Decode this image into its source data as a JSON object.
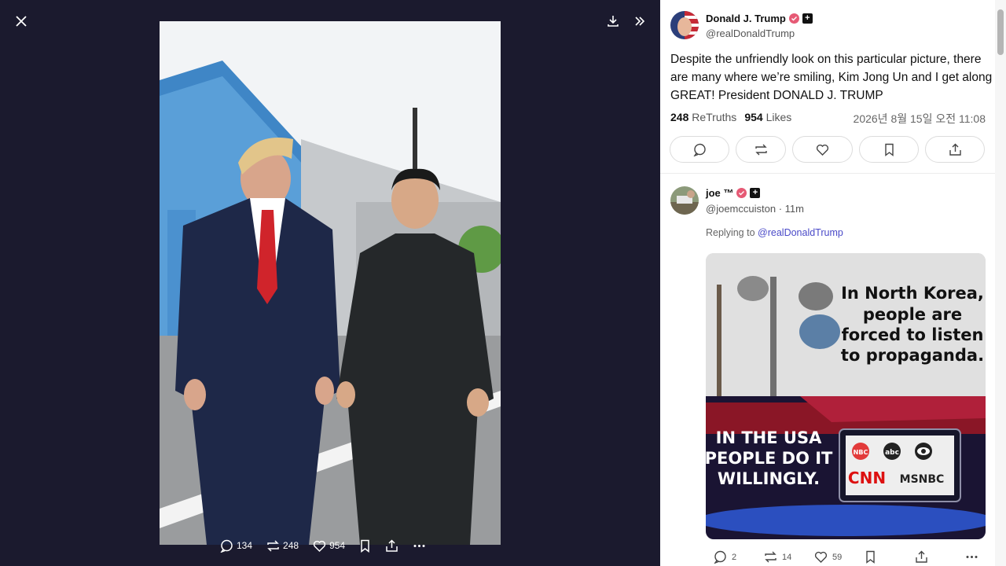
{
  "viewer": {
    "actions": {
      "replies": "134",
      "retruths": "248",
      "likes": "954"
    }
  },
  "post": {
    "author_name": "Donald J. Trump",
    "author_handle": "@realDonaldTrump",
    "text": "Despite the unfriendly look on this particular picture, there are many where we’re smiling, Kim Jong Un and I get along GREAT! President DONALD J. TRUMP",
    "retruths_count": "248",
    "retruths_label": "ReTruths",
    "likes_count": "954",
    "likes_label": "Likes",
    "datetime": "2026년 8월 15일 오전 11:08"
  },
  "reply": {
    "author_name": "joe ™",
    "author_handle": "@joemccuiston",
    "time": "· 11m",
    "replying_prefix": "Replying to",
    "replying_handle": "@realDonaldTrump",
    "image_text_top": [
      "In North Korea,",
      "people are",
      "forced to listen",
      "to propaganda."
    ],
    "image_text_bottom": [
      "IN THE USA",
      "PEOPLE DO IT",
      "WILLINGLY."
    ],
    "network_logos": [
      "NBC",
      "abc",
      "CNN",
      "MSNBC"
    ],
    "counts": {
      "replies": "2",
      "retruths": "14",
      "likes": "59"
    }
  },
  "colors": {
    "viewer_bg": "#1b1a2e",
    "verified": "#e65a75",
    "link": "#4a4ac8"
  }
}
